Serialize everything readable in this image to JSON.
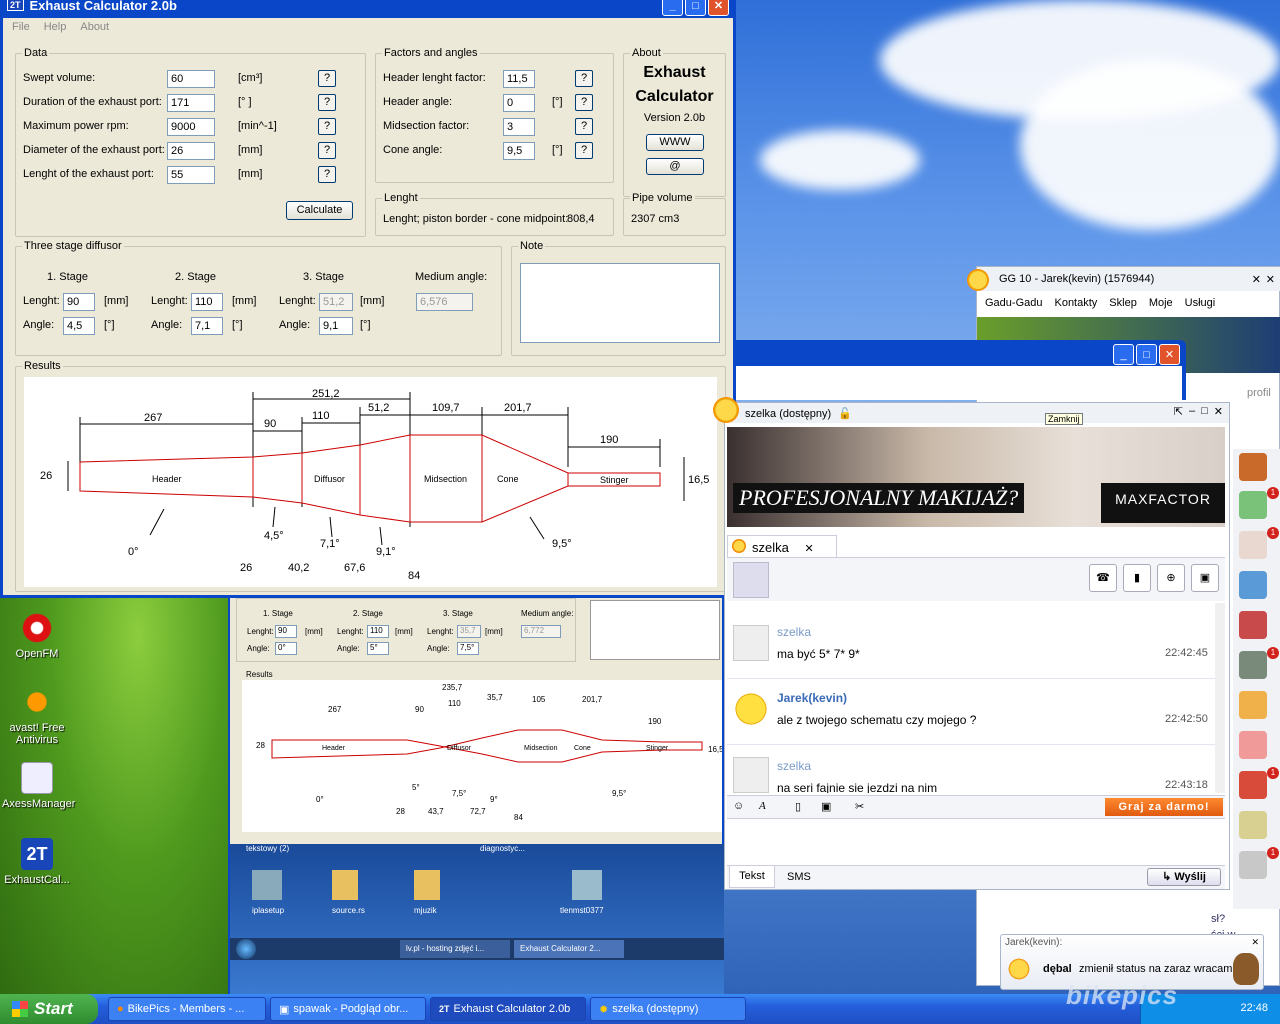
{
  "exhaust": {
    "title": "Exhaust Calculator 2.0b",
    "menu": [
      "File",
      "Help",
      "About"
    ],
    "data": {
      "legend": "Data",
      "rows": [
        {
          "label": "Swept volume:",
          "value": "60",
          "unit": "[cm³]"
        },
        {
          "label": "Duration of the exhaust port:",
          "value": "171",
          "unit": "[° ]"
        },
        {
          "label": "Maximum power rpm:",
          "value": "9000",
          "unit": "[min^-1]"
        },
        {
          "label": "Diameter of the exhaust port:",
          "value": "26",
          "unit": "[mm]"
        },
        {
          "label": "Lenght of the exhaust port:",
          "value": "55",
          "unit": "[mm]"
        }
      ],
      "help": "?",
      "calculate": "Calculate"
    },
    "factors": {
      "legend": "Factors and angles",
      "rows": [
        {
          "label": "Header lenght factor:",
          "value": "11,5",
          "unit": ""
        },
        {
          "label": "Header angle:",
          "value": "0",
          "unit": "[°]"
        },
        {
          "label": "Midsection factor:",
          "value": "3",
          "unit": ""
        },
        {
          "label": "Cone angle:",
          "value": "9,5",
          "unit": "[°]"
        }
      ]
    },
    "about": {
      "legend": "About",
      "line1": "Exhaust",
      "line2": "Calculator",
      "version": "Version 2.0b",
      "www": "WWW",
      "at": "@"
    },
    "lenght": {
      "legend": "Lenght",
      "text": "Lenght; piston border - cone midpoint:",
      "value": "808,4"
    },
    "pipe": {
      "legend": "Pipe volume",
      "value": "2307 cm3"
    },
    "diffuser": {
      "legend": "Three stage diffusor",
      "stages": [
        "1. Stage",
        "2. Stage",
        "3. Stage"
      ],
      "medium_label": "Medium angle:",
      "lenght_label": "Lenght:",
      "angle_label": "Angle:",
      "mm": "[mm]",
      "deg": "[°]",
      "lenghts": [
        "90",
        "110",
        "51,2"
      ],
      "angles": [
        "4,5",
        "7,1",
        "9,1"
      ],
      "medium": "6,576"
    },
    "note": {
      "legend": "Note"
    },
    "results": {
      "legend": "Results",
      "top_dims": [
        "251,2",
        "267",
        "90",
        "110",
        "51,2",
        "109,7",
        "201,7",
        "190"
      ],
      "sections": [
        "Header",
        "Diffusor",
        "Midsection",
        "Cone",
        "Stinger"
      ],
      "left_dim": "26",
      "right_dim": "16,5",
      "angles": [
        "0°",
        "4,5°",
        "7,1°",
        "9,1°",
        "9,5°"
      ],
      "bottom_dims": [
        "26",
        "40,2",
        "67,6",
        "84"
      ]
    }
  },
  "bgwin": {
    "stages": [
      "1. Stage",
      "2. Stage",
      "3. Stage"
    ],
    "medium_label": "Medium angle:",
    "lenghts": [
      "90",
      "110",
      "35,7"
    ],
    "angles": [
      "0°",
      "5°",
      "7,5°",
      "9°",
      "9,5°"
    ],
    "medium": "6,772",
    "results": "Results",
    "top_dims": [
      "235,7",
      "267",
      "90",
      "110",
      "35,7",
      "105",
      "201,7",
      "190"
    ],
    "sections": [
      "Header",
      "Diffusor",
      "Midsection",
      "Cone",
      "Stinger"
    ],
    "left_dim": "28",
    "right_dim": "16,5",
    "bottom_dims": [
      "28",
      "43,7",
      "72,7",
      "84"
    ],
    "icons": [
      "iplasetup",
      "source.rs",
      "mjuzik",
      "tlenmst0377"
    ],
    "folder_labels": [
      "tekstowy (2)",
      "diagnostyc..."
    ],
    "taskbar": [
      "lv.pl - hosting zdjęć i...",
      "Exhaust Calculator 2..."
    ]
  },
  "desktop": {
    "icons": [
      "OpenFM",
      "avast! Free Antivirus",
      "AxessManager",
      "ExhaustCal..."
    ]
  },
  "gg": {
    "title": "GG 10 - Jarek(kevin) (1576944)",
    "menu": [
      "Gadu-Gadu",
      "Kontakty",
      "Sklep",
      "Moje",
      "Usługi"
    ],
    "profil": "profil",
    "chat_title": "szelka (dostępny)",
    "close_tooltip": "Zamknij",
    "ad_text": "PROFESJONALNY MAKIJAŻ?",
    "ad_brand": "MAXFACTOR",
    "tab": "szelka",
    "messages": [
      {
        "author": "szelka",
        "text": "ma być 5*   7*  9*",
        "time": "22:42:45"
      },
      {
        "author": "Jarek(kevin)",
        "text": "ale z twojego schematu czy mojego ?",
        "time": "22:42:50"
      },
      {
        "author": "szelka",
        "text": "na seri fajnie sie jezdzi na nim",
        "time": "22:43:18"
      }
    ],
    "game_btn": "Graj za darmo!",
    "tabs": [
      "Tekst",
      "SMS"
    ],
    "send": "Wyślij",
    "notify_title": "Jarek(kevin):",
    "notify_name": "dębal",
    "notify_text": "zmienił status na zaraz wracam",
    "side_partial": [
      "sł?",
      "ści w"
    ]
  },
  "taskbar": {
    "start": "Start",
    "items": [
      "BikePics - Members - ...",
      "spawak - Podgląd obr...",
      "Exhaust Calculator 2.0b",
      "szelka (dostępny)"
    ],
    "clock": "22:48",
    "watermark": "bikepics"
  }
}
